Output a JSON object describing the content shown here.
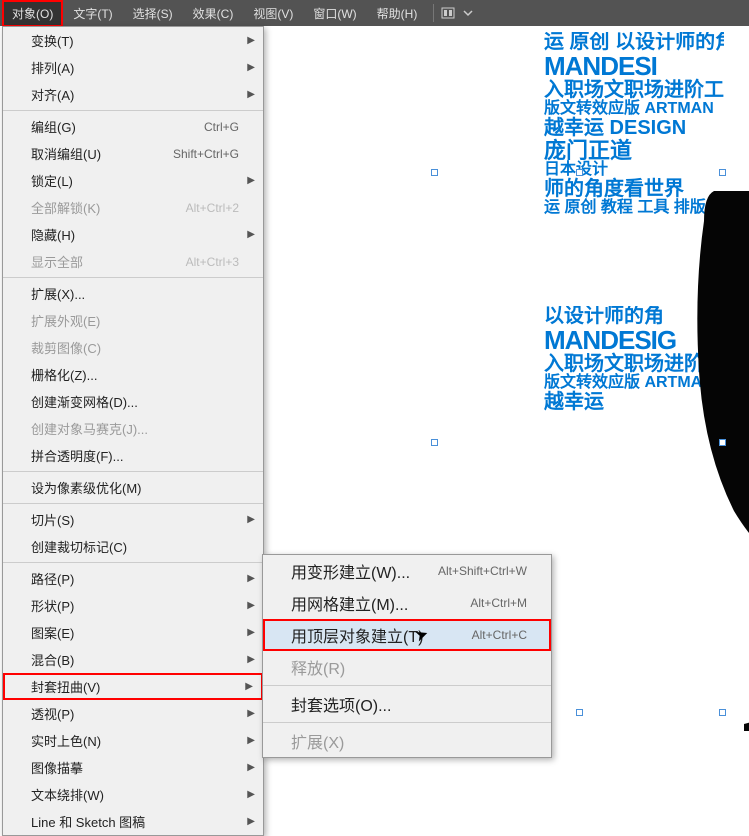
{
  "menubar": {
    "items": [
      {
        "label": "对象(O)",
        "active": true
      },
      {
        "label": "文字(T)"
      },
      {
        "label": "选择(S)"
      },
      {
        "label": "效果(C)"
      },
      {
        "label": "视图(V)"
      },
      {
        "label": "窗口(W)"
      },
      {
        "label": "帮助(H)"
      }
    ]
  },
  "dropdown": {
    "groups": [
      [
        {
          "label": "变换(T)",
          "arrow": true
        },
        {
          "label": "排列(A)",
          "arrow": true
        },
        {
          "label": "对齐(A)",
          "arrow": true
        }
      ],
      [
        {
          "label": "编组(G)",
          "shortcut": "Ctrl+G"
        },
        {
          "label": "取消编组(U)",
          "shortcut": "Shift+Ctrl+G"
        },
        {
          "label": "锁定(L)",
          "arrow": true
        },
        {
          "label": "全部解锁(K)",
          "shortcut": "Alt+Ctrl+2",
          "disabled": true
        },
        {
          "label": "隐藏(H)",
          "arrow": true
        },
        {
          "label": "显示全部",
          "shortcut": "Alt+Ctrl+3",
          "disabled": true
        }
      ],
      [
        {
          "label": "扩展(X)..."
        },
        {
          "label": "扩展外观(E)",
          "disabled": true
        },
        {
          "label": "裁剪图像(C)",
          "disabled": true
        },
        {
          "label": "栅格化(Z)..."
        },
        {
          "label": "创建渐变网格(D)..."
        },
        {
          "label": "创建对象马赛克(J)...",
          "disabled": true
        },
        {
          "label": "拼合透明度(F)..."
        }
      ],
      [
        {
          "label": "设为像素级优化(M)"
        }
      ],
      [
        {
          "label": "切片(S)",
          "arrow": true
        },
        {
          "label": "创建裁切标记(C)"
        }
      ],
      [
        {
          "label": "路径(P)",
          "arrow": true
        },
        {
          "label": "形状(P)",
          "arrow": true
        },
        {
          "label": "图案(E)",
          "arrow": true
        },
        {
          "label": "混合(B)",
          "arrow": true
        },
        {
          "label": "封套扭曲(V)",
          "arrow": true,
          "highlight": true
        },
        {
          "label": "透视(P)",
          "arrow": true
        },
        {
          "label": "实时上色(N)",
          "arrow": true
        },
        {
          "label": "图像描摹",
          "arrow": true
        },
        {
          "label": "文本绕排(W)",
          "arrow": true
        },
        {
          "label": "Line 和 Sketch 图稿",
          "arrow": true
        }
      ]
    ]
  },
  "submenu": {
    "items": [
      {
        "label": "用变形建立(W)...",
        "shortcut": "Alt+Shift+Ctrl+W"
      },
      {
        "label": "用网格建立(M)...",
        "shortcut": "Alt+Ctrl+M"
      },
      {
        "label": "用顶层对象建立(T)",
        "shortcut": "Alt+Ctrl+C",
        "highlight": true
      },
      {
        "label": "释放(R)",
        "disabled": true
      },
      {
        "sep": true
      },
      {
        "label": "封套选项(O)..."
      },
      {
        "sep": true
      },
      {
        "label": "扩展(X)",
        "disabled": true
      }
    ]
  },
  "canvas": {
    "text_lines_block1": [
      "运 原创 以设计师的角",
      "MANDESI",
      "入职场文职场进阶工",
      "版文转效应版 ARTMAN",
      "越幸运 DESIGN",
      "庞门正道",
      "日本设计",
      "师的角度看世界",
      "运 原创 教程 工具 排版 文"
    ],
    "text_lines_block2": [
      "以设计师的角",
      "MANDESIG",
      "入职场文职场进阶工 庞",
      "版文转效应版 ARTMAN 门",
      "越幸运"
    ]
  }
}
